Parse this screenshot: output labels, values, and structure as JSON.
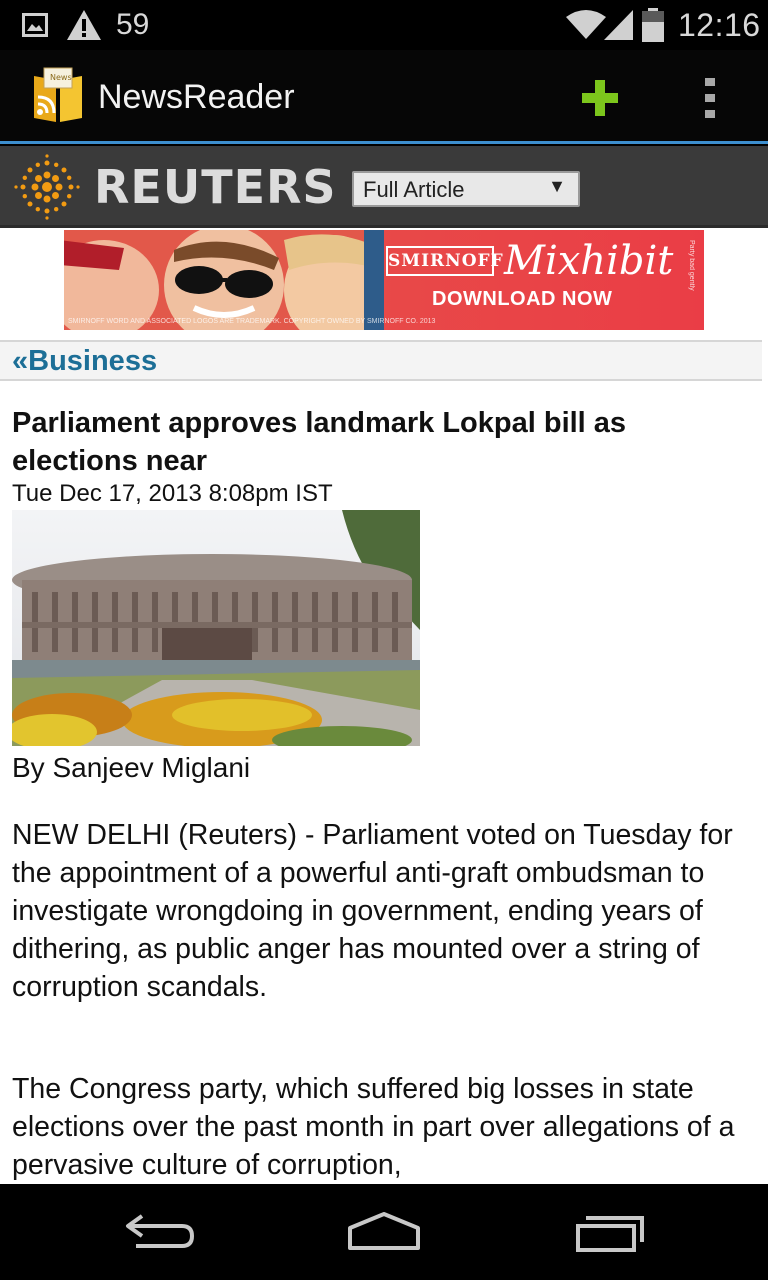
{
  "status_bar": {
    "notification_count": "59",
    "time": "12:16",
    "icons": [
      "gallery-icon",
      "warning-icon",
      "wifi-icon",
      "signal-icon",
      "battery-icon"
    ]
  },
  "action_bar": {
    "title": "NewsReader",
    "icons": [
      "app-icon",
      "add-icon",
      "overflow-menu-icon"
    ],
    "accent_color": "#3d8fcf",
    "add_color": "#7cc61c"
  },
  "source_bar": {
    "wordmark": "REUTERS",
    "view_select": {
      "selected": "Full Article",
      "arrow": "▼"
    }
  },
  "ad": {
    "brand": "SMIRNOFF",
    "product": "Mixhibit",
    "cta": "DOWNLOAD NOW",
    "fineprint": "SMIRNOFF WORD AND ASSOCIATED LOGOS ARE TRADEMARK. COPYRIGHT OWNED BY SMIRNOFF CO. 2013",
    "side_text": "Party bad gently"
  },
  "section": {
    "back_label": "«Business",
    "color": "#1d6f97"
  },
  "article": {
    "headline": "Parliament approves landmark Lokpal bill as elections near",
    "dateline": "Tue Dec 17, 2013 8:08pm IST",
    "byline": "By Sanjeev Miglani",
    "paragraphs": [
      "NEW DELHI (Reuters) - Parliament voted on Tuesday for the appointment of a powerful anti-graft ombudsman to investigate wrongdoing in government, ending years of dithering, as public anger has mounted over a string of corruption scandals.",
      "The Congress party, which suffered big losses in state elections over the past month in part over allegations of a pervasive culture of corruption,"
    ]
  },
  "nav_bar": {
    "icons": [
      "back-icon",
      "home-icon",
      "recent-apps-icon"
    ]
  }
}
